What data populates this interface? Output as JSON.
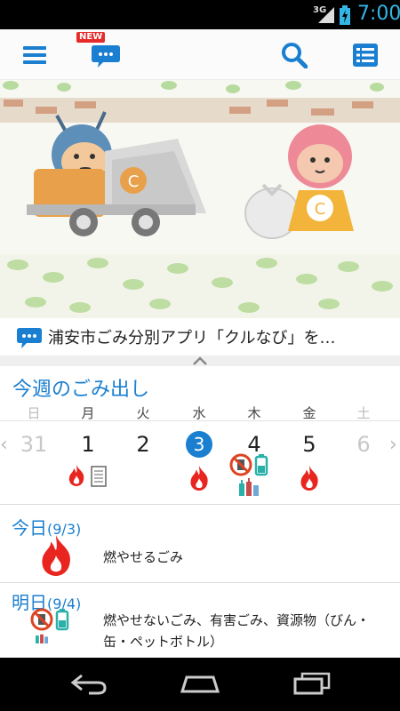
{
  "status": {
    "network": "3G",
    "time": "7:00"
  },
  "appbar": {
    "new_badge": "NEW"
  },
  "news": {
    "text": "浦安市ごみ分別アプリ「クルなび」を…"
  },
  "week": {
    "title": "今週のごみ出し",
    "weekdays": [
      "日",
      "月",
      "火",
      "水",
      "木",
      "金",
      "土"
    ],
    "days": [
      {
        "num": "31",
        "muted": true,
        "icons": []
      },
      {
        "num": "1",
        "muted": false,
        "icons": [
          "flame-icon",
          "paper-icon"
        ]
      },
      {
        "num": "2",
        "muted": false,
        "icons": []
      },
      {
        "num": "3",
        "muted": false,
        "today": true,
        "icons": [
          "flame-icon"
        ]
      },
      {
        "num": "4",
        "muted": false,
        "icons": [
          "nonburnable-icon",
          "battery-icon",
          "bottles-icon"
        ]
      },
      {
        "num": "5",
        "muted": false,
        "icons": [
          "flame-icon"
        ]
      },
      {
        "num": "6",
        "muted": true,
        "icons": []
      }
    ]
  },
  "today": {
    "label": "今日",
    "date": "(9/3)",
    "desc": "燃やせるごみ"
  },
  "tomorrow": {
    "label": "明日",
    "date": "(9/4)",
    "desc": "燃やせないごみ、有害ごみ、資源物（びん・缶・ペットボトル）"
  },
  "colors": {
    "accent": "#1a7fd0",
    "flame": "#e8251f",
    "hazard": "#2ab0a8"
  }
}
